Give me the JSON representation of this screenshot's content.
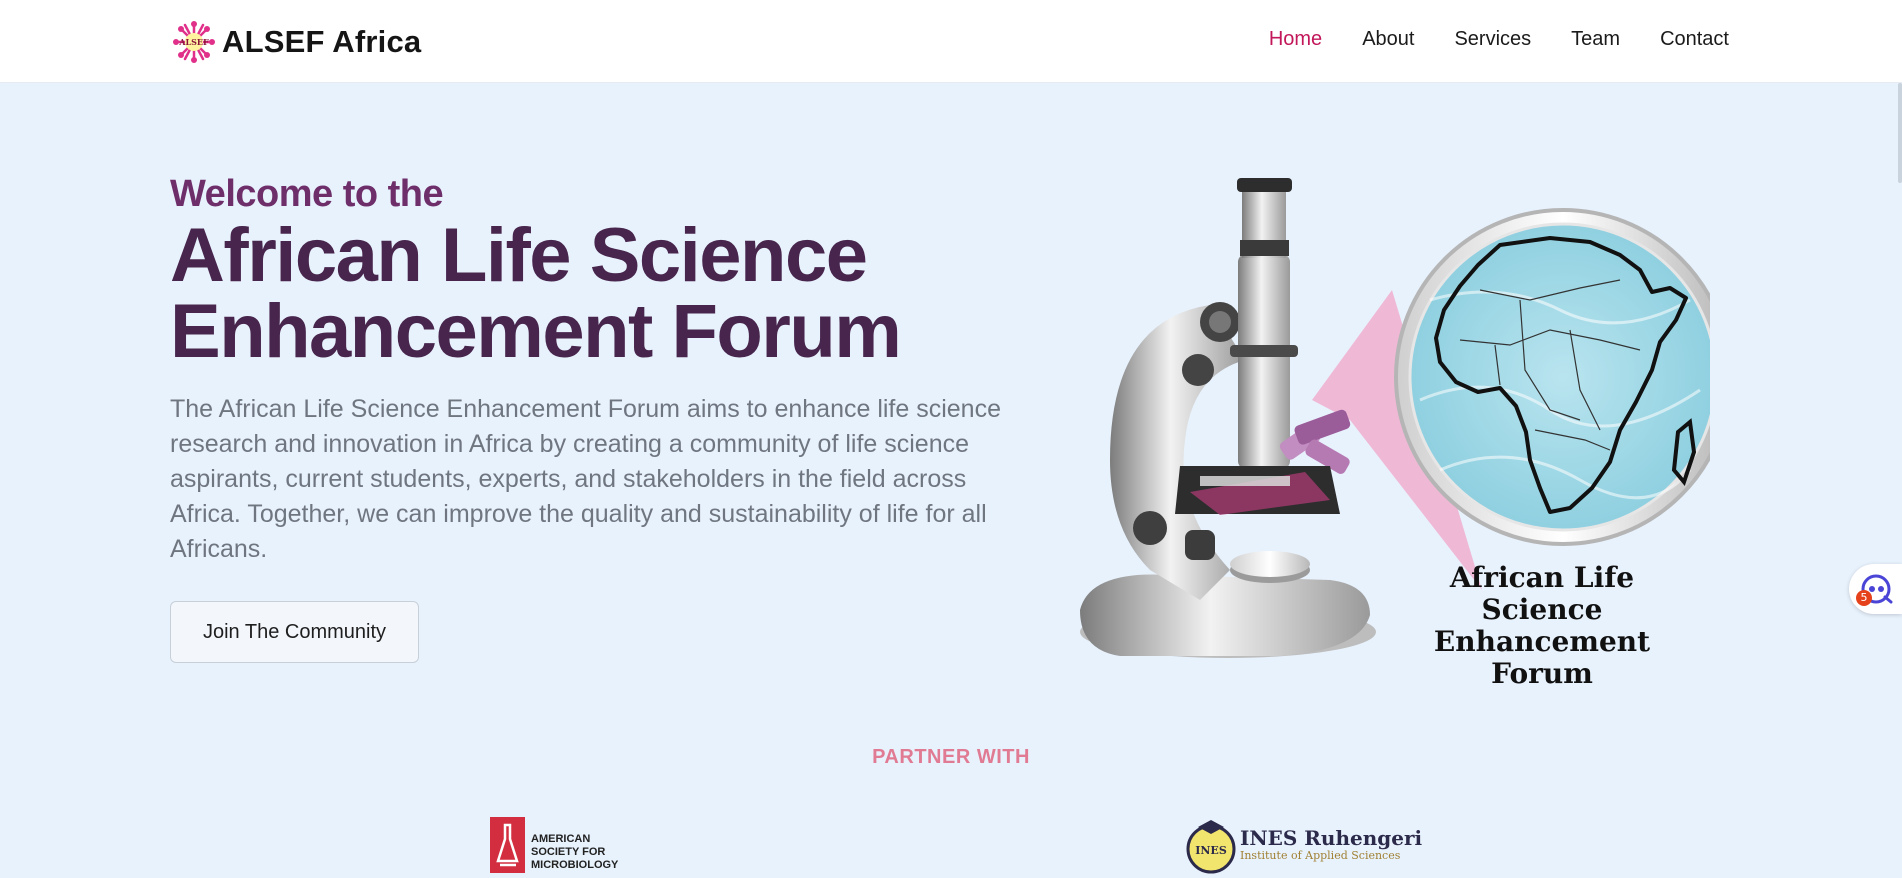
{
  "brand": {
    "logo_text": "ALSEF",
    "name": "ALSEF Africa"
  },
  "nav": {
    "items": [
      {
        "label": "Home",
        "active": true
      },
      {
        "label": "About"
      },
      {
        "label": "Services"
      },
      {
        "label": "Team"
      },
      {
        "label": "Contact"
      }
    ]
  },
  "hero": {
    "welcome": "Welcome to the",
    "title_line1": "African Life Science",
    "title_line2": "Enhancement Forum",
    "description": "The African Life Science Enhancement Forum aims to enhance life science research and innovation in Africa by creating a community of life science aspirants, current students, experts, and stakeholders in the field across Africa. Together, we can improve the quality and sustainability of life for all Africans.",
    "cta_label": "Join The Community",
    "art_caption_line1": "African Life Science",
    "art_caption_line2": "Enhancement Forum"
  },
  "partners": {
    "heading": "PARTNER WITH",
    "asm": {
      "line1": "AMERICAN",
      "line2": "SOCIETY FOR",
      "line3": "MICROBIOLOGY"
    },
    "ines": {
      "name": "INES Ruhengeri",
      "subtitle": "Institute of Applied Sciences",
      "seal_text": "INES"
    }
  },
  "widget": {
    "badge_count": "5"
  },
  "colors": {
    "accent": "#c2185b",
    "welcome": "#6d2e6a",
    "title": "#47254d",
    "partner_heading": "#e07b93",
    "background": "#e8f2fd"
  }
}
